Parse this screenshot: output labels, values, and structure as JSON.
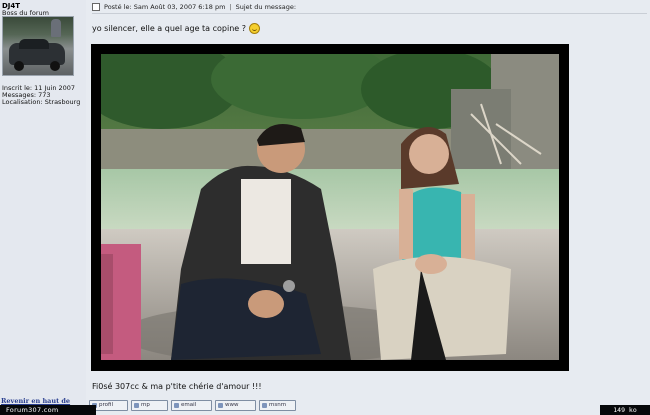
{
  "author": {
    "username": "DJ4T",
    "rank": "Boss du forum",
    "joined": "Inscrit le: 11 Juin 2007",
    "messages": "Messages: 773",
    "location": "Localisation: Strasbourg"
  },
  "post": {
    "header_text": "Posté le: Sam Août 03, 2007 6:18 pm",
    "separator": "|",
    "subject_label": "Sujet du message:",
    "message_line1": "yo silencer, elle a quel age ta copine ?",
    "message_line2": "Fi0sé 307cc & ma p'tite chérie d'amour !!!"
  },
  "actions": {
    "profile": "profil",
    "pm": "mp",
    "email": "email",
    "www": "www",
    "msn": "msnm"
  },
  "footer": {
    "back_to_top": "Revenir en haut de",
    "site": "Forum307.com",
    "size": "149 ko"
  }
}
